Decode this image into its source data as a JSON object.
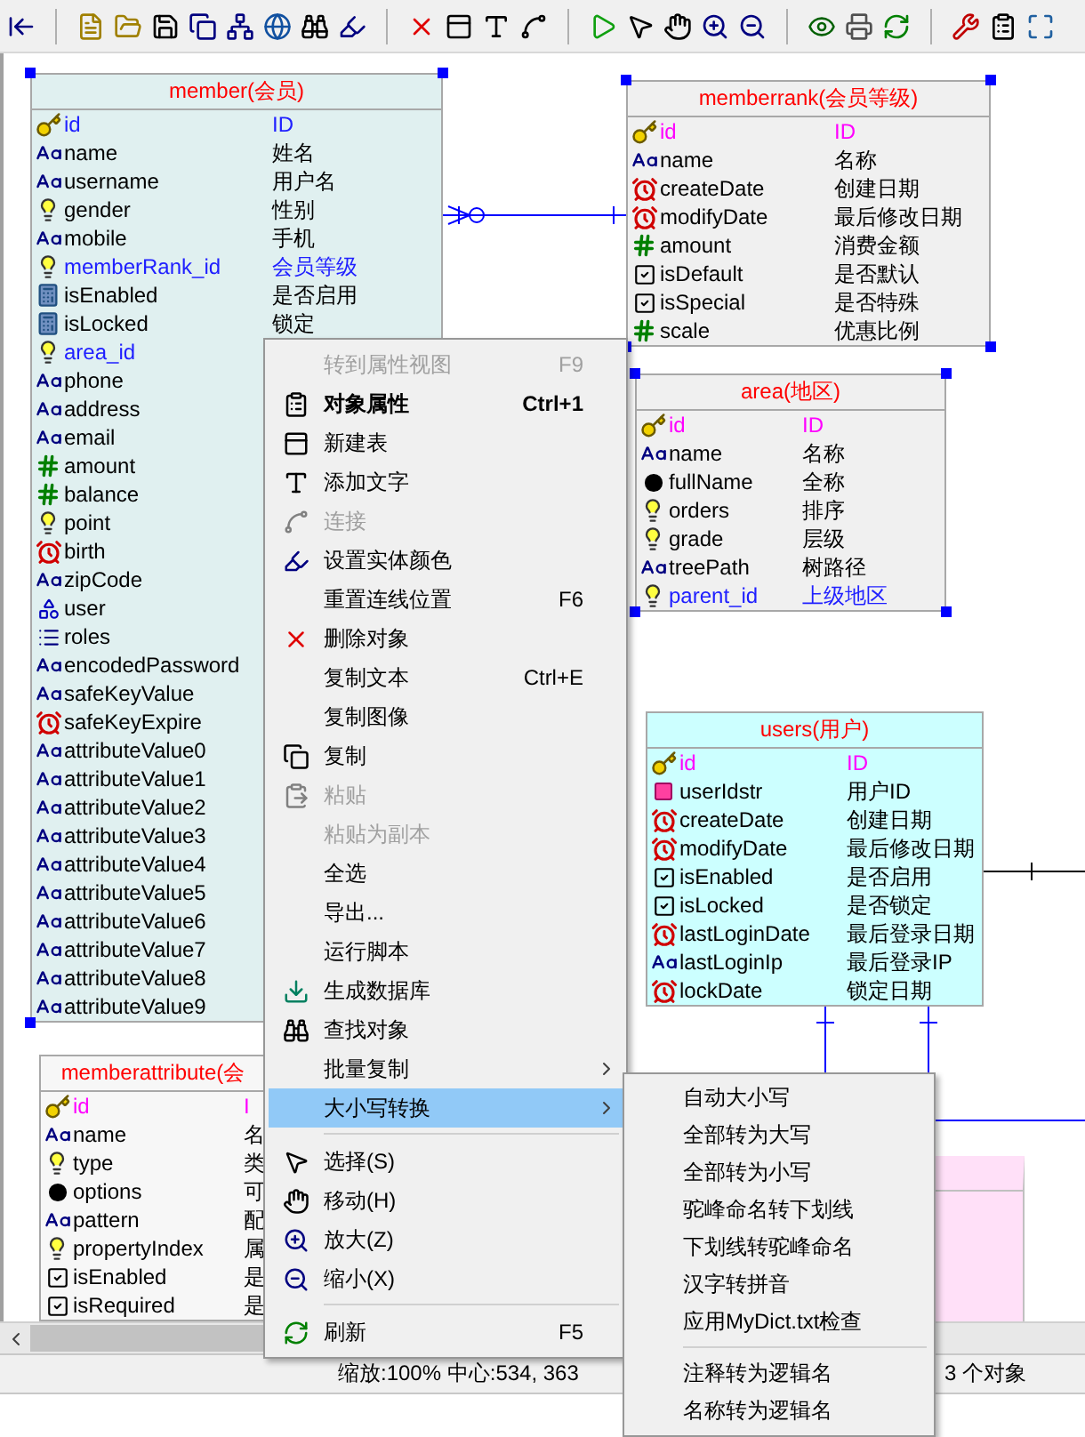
{
  "tables": [
    {
      "title": "member(会员)",
      "color": "#e0f0f0",
      "selected": true,
      "fields": [
        {
          "kind": "key",
          "name": "id",
          "comment": "ID",
          "color": "#2020ff"
        },
        {
          "kind": "string",
          "name": "name",
          "comment": "姓名"
        },
        {
          "kind": "string",
          "name": "username",
          "comment": "用户名"
        },
        {
          "kind": "enum",
          "name": "gender",
          "comment": "性别"
        },
        {
          "kind": "string",
          "name": "mobile",
          "comment": "手机"
        },
        {
          "kind": "enum",
          "name": "memberRank_id",
          "comment": "会员等级",
          "color": "#2020ff"
        },
        {
          "kind": "boolean",
          "name": "isEnabled",
          "comment": "是否启用"
        },
        {
          "kind": "boolean",
          "name": "isLocked",
          "comment": "锁定"
        },
        {
          "kind": "enum",
          "name": "area_id",
          "color": "#2020ff"
        },
        {
          "kind": "string",
          "name": "phone"
        },
        {
          "kind": "string",
          "name": "address"
        },
        {
          "kind": "string",
          "name": "email"
        },
        {
          "kind": "decimal",
          "name": "amount"
        },
        {
          "kind": "decimal",
          "name": "balance"
        },
        {
          "kind": "enum",
          "name": "point"
        },
        {
          "kind": "datetime",
          "name": "birth"
        },
        {
          "kind": "string",
          "name": "zipCode"
        },
        {
          "kind": "object",
          "name": "user"
        },
        {
          "kind": "list",
          "name": "roles"
        },
        {
          "kind": "string",
          "name": "encodedPassword"
        },
        {
          "kind": "string",
          "name": "safeKeyValue"
        },
        {
          "kind": "datetime",
          "name": "safeKeyExpire"
        },
        {
          "kind": "string",
          "name": "attributeValue0"
        },
        {
          "kind": "string",
          "name": "attributeValue1"
        },
        {
          "kind": "string",
          "name": "attributeValue2"
        },
        {
          "kind": "string",
          "name": "attributeValue3"
        },
        {
          "kind": "string",
          "name": "attributeValue4"
        },
        {
          "kind": "string",
          "name": "attributeValue5"
        },
        {
          "kind": "string",
          "name": "attributeValue6"
        },
        {
          "kind": "string",
          "name": "attributeValue7"
        },
        {
          "kind": "string",
          "name": "attributeValue8"
        },
        {
          "kind": "string",
          "name": "attributeValue9"
        }
      ]
    },
    {
      "title": "memberrank(会员等级)",
      "color": "#f0f0f0",
      "selected": true,
      "fields": [
        {
          "kind": "key",
          "name": "id",
          "comment": "ID",
          "color": "#ff00ff"
        },
        {
          "kind": "string",
          "name": "name",
          "comment": "名称"
        },
        {
          "kind": "datetime",
          "name": "createDate",
          "comment": "创建日期"
        },
        {
          "kind": "datetime",
          "name": "modifyDate",
          "comment": "最后修改日期"
        },
        {
          "kind": "decimal",
          "name": "amount",
          "comment": "消费金额"
        },
        {
          "kind": "check",
          "name": "isDefault",
          "comment": "是否默认"
        },
        {
          "kind": "check",
          "name": "isSpecial",
          "comment": "是否特殊"
        },
        {
          "kind": "decimal",
          "name": "scale",
          "comment": "优惠比例"
        }
      ]
    },
    {
      "title": "area(地区)",
      "color": "#f0f0f0",
      "selected": true,
      "fields": [
        {
          "kind": "key",
          "name": "id",
          "comment": "ID",
          "color": "#ff00ff"
        },
        {
          "kind": "string",
          "name": "name",
          "comment": "名称"
        },
        {
          "kind": "text",
          "name": "fullName",
          "comment": "全称"
        },
        {
          "kind": "enum",
          "name": "orders",
          "comment": "排序"
        },
        {
          "kind": "enum",
          "name": "grade",
          "comment": "层级"
        },
        {
          "kind": "string",
          "name": "treePath",
          "comment": "树路径"
        },
        {
          "kind": "enum",
          "name": "parent_id",
          "comment": "上级地区",
          "color": "#2020ff"
        }
      ]
    },
    {
      "title": "users(用户)",
      "color": "#ccffff",
      "selected": false,
      "fields": [
        {
          "kind": "key",
          "name": "id",
          "comment": "ID",
          "color": "#ff00ff"
        },
        {
          "kind": "binary",
          "name": "userIdstr",
          "comment": "用户ID"
        },
        {
          "kind": "datetime",
          "name": "createDate",
          "comment": "创建日期"
        },
        {
          "kind": "datetime",
          "name": "modifyDate",
          "comment": "最后修改日期"
        },
        {
          "kind": "check",
          "name": "isEnabled",
          "comment": "是否启用"
        },
        {
          "kind": "check",
          "name": "isLocked",
          "comment": "是否锁定"
        },
        {
          "kind": "datetime",
          "name": "lastLoginDate",
          "comment": "最后登录日期"
        },
        {
          "kind": "string",
          "name": "lastLoginIp",
          "comment": "最后登录IP"
        },
        {
          "kind": "datetime",
          "name": "lockDate",
          "comment": "锁定日期"
        }
      ]
    },
    {
      "title": "memberattribute(会",
      "color": "#f7f7f7",
      "selected": false,
      "fields": [
        {
          "kind": "key",
          "name": "id",
          "comment": "I",
          "color": "#ff00ff"
        },
        {
          "kind": "string",
          "name": "name",
          "comment": "名"
        },
        {
          "kind": "enum",
          "name": "type",
          "comment": "类"
        },
        {
          "kind": "text",
          "name": "options",
          "comment": "可"
        },
        {
          "kind": "string",
          "name": "pattern",
          "comment": "配"
        },
        {
          "kind": "enum",
          "name": "propertyIndex",
          "comment": "属"
        },
        {
          "kind": "check",
          "name": "isEnabled",
          "comment": "是"
        },
        {
          "kind": "check",
          "name": "isRequired",
          "comment": "是"
        }
      ]
    }
  ],
  "context_menu": {
    "groups": [
      [
        {
          "label": "转到属性视图",
          "shortcut": "F9",
          "disabled": true,
          "default": false,
          "selected": false
        },
        {
          "label": "对象属性",
          "shortcut": "Ctrl+1",
          "disabled": false,
          "default": true,
          "selected": false
        },
        {
          "label": "新建表",
          "disabled": false,
          "default": false,
          "selected": false
        },
        {
          "label": "添加文字",
          "disabled": false,
          "default": false,
          "selected": false
        },
        {
          "label": "连接",
          "disabled": true,
          "default": false,
          "selected": false
        },
        {
          "label": "设置实体颜色",
          "disabled": false,
          "default": false,
          "selected": false
        },
        {
          "label": "重置连线位置",
          "shortcut": "F6",
          "disabled": false,
          "default": false,
          "selected": false
        },
        {
          "label": "删除对象",
          "disabled": false,
          "default": false,
          "selected": false
        },
        {
          "label": "复制文本",
          "shortcut": "Ctrl+E",
          "disabled": false,
          "default": false,
          "selected": false
        },
        {
          "label": "复制图像",
          "disabled": false,
          "default": false,
          "selected": false
        },
        {
          "label": "复制",
          "disabled": false,
          "default": false,
          "selected": false
        },
        {
          "label": "粘贴",
          "disabled": true,
          "default": false,
          "selected": false
        },
        {
          "label": "粘贴为副本",
          "disabled": true,
          "default": false,
          "selected": false
        },
        {
          "label": "全选",
          "disabled": false,
          "default": false,
          "selected": false
        },
        {
          "label": "导出...",
          "disabled": false,
          "default": false,
          "selected": false
        },
        {
          "label": "运行脚本",
          "disabled": false,
          "default": false,
          "selected": false
        },
        {
          "label": "生成数据库",
          "disabled": false,
          "default": false,
          "selected": false
        },
        {
          "label": "查找对象",
          "disabled": false,
          "default": false,
          "selected": false
        },
        {
          "label": "批量复制",
          "submenu": true,
          "disabled": false,
          "default": false,
          "selected": false
        },
        {
          "label": "大小写转换",
          "submenu": true,
          "disabled": false,
          "default": false,
          "selected": true
        }
      ],
      [
        {
          "label": "选择(S)",
          "disabled": false,
          "default": false,
          "selected": false
        },
        {
          "label": "移动(H)",
          "disabled": false,
          "default": false,
          "selected": false
        },
        {
          "label": "放大(Z)",
          "disabled": false,
          "default": false,
          "selected": false
        },
        {
          "label": "缩小(X)",
          "disabled": false,
          "default": false,
          "selected": false
        }
      ],
      [
        {
          "label": "刷新",
          "shortcut": "F5",
          "disabled": false,
          "default": false,
          "selected": false
        }
      ]
    ]
  },
  "submenu": {
    "groups": [
      [
        {
          "label": "自动大小写",
          "selected": false
        },
        {
          "label": "全部转为大写",
          "selected": false
        },
        {
          "label": "全部转为小写",
          "selected": false
        },
        {
          "label": "驼峰命名转下划线",
          "selected": false
        },
        {
          "label": "下划线转驼峰命名",
          "selected": false
        },
        {
          "label": "汉字转拼音",
          "selected": false
        },
        {
          "label": "应用MyDict.txt检查",
          "selected": false
        }
      ],
      [
        {
          "label": "注释转为逻辑名",
          "selected": false
        },
        {
          "label": "名称转为逻辑名",
          "selected": false
        }
      ]
    ]
  },
  "status_bar": {
    "zoom_center": "缩放:100% 中心:534, 363",
    "objects": "3 个对象"
  }
}
